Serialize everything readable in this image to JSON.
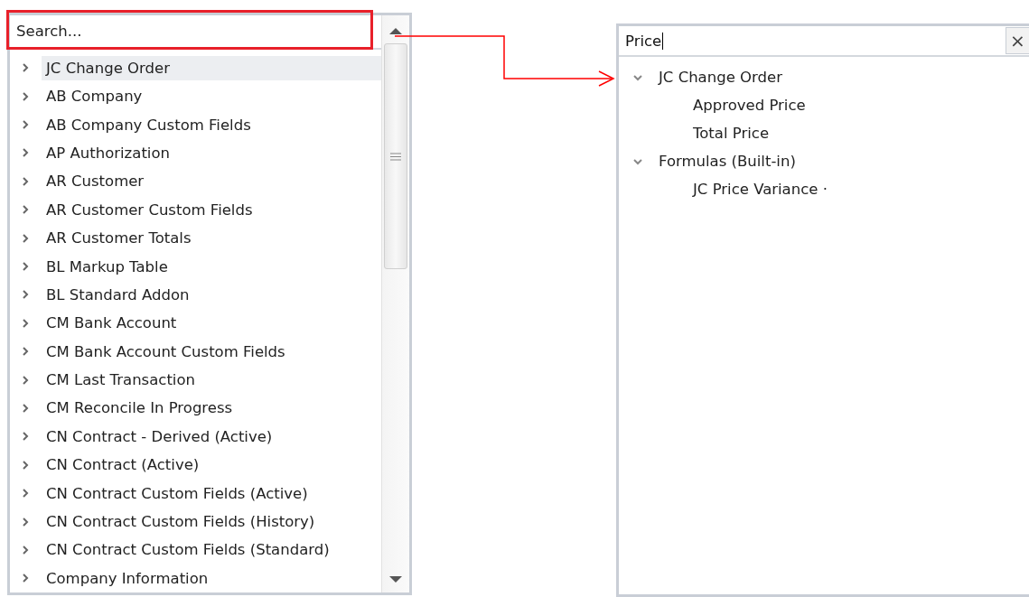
{
  "left_panel": {
    "search": {
      "placeholder": "Search..."
    },
    "items": [
      {
        "label": "JC Change Order",
        "expanded": false,
        "selected": true
      },
      {
        "label": "AB Company",
        "expanded": false,
        "selected": false
      },
      {
        "label": "AB Company Custom Fields",
        "expanded": false,
        "selected": false
      },
      {
        "label": "AP Authorization",
        "expanded": false,
        "selected": false
      },
      {
        "label": "AR Customer",
        "expanded": false,
        "selected": false
      },
      {
        "label": "AR Customer Custom Fields",
        "expanded": false,
        "selected": false
      },
      {
        "label": "AR Customer Totals",
        "expanded": false,
        "selected": false
      },
      {
        "label": "BL Markup Table",
        "expanded": false,
        "selected": false
      },
      {
        "label": "BL Standard Addon",
        "expanded": false,
        "selected": false
      },
      {
        "label": "CM Bank Account",
        "expanded": false,
        "selected": false
      },
      {
        "label": "CM Bank Account Custom Fields",
        "expanded": false,
        "selected": false
      },
      {
        "label": "CM Last Transaction",
        "expanded": false,
        "selected": false
      },
      {
        "label": "CM Reconcile In Progress",
        "expanded": false,
        "selected": false
      },
      {
        "label": "CN Contract - Derived (Active)",
        "expanded": false,
        "selected": false
      },
      {
        "label": "CN Contract (Active)",
        "expanded": false,
        "selected": false
      },
      {
        "label": "CN Contract Custom Fields (Active)",
        "expanded": false,
        "selected": false
      },
      {
        "label": "CN Contract Custom Fields (History)",
        "expanded": false,
        "selected": false
      },
      {
        "label": "CN Contract Custom Fields (Standard)",
        "expanded": false,
        "selected": false
      },
      {
        "label": "Company Information",
        "expanded": false,
        "selected": false
      }
    ]
  },
  "right_panel": {
    "search": {
      "value": "Price",
      "clear": "×"
    },
    "items": [
      {
        "label": "JC Change Order",
        "expanded": true,
        "children": [
          {
            "label": "Approved Price"
          },
          {
            "label": "Total Price"
          }
        ]
      },
      {
        "label": "Formulas (Built-in)",
        "expanded": true,
        "children": [
          {
            "label": "JC Price Variance ·"
          }
        ]
      }
    ]
  }
}
